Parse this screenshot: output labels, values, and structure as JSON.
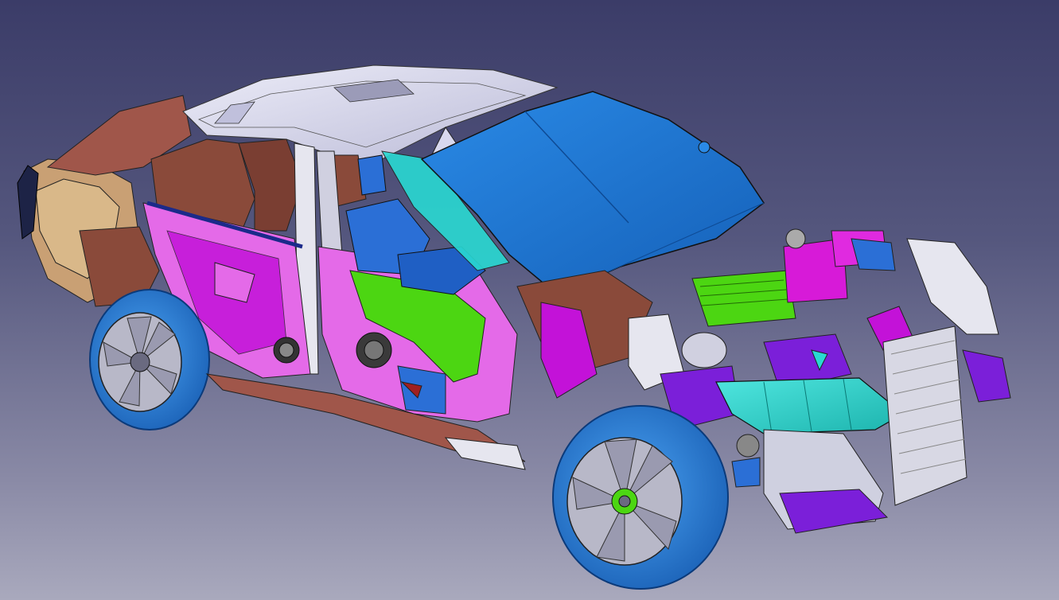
{
  "viewport": {
    "background_top": "#3b3c68",
    "background_bottom": "#a9a9bd"
  },
  "model": {
    "colors": {
      "hood": "#1f78d1",
      "roof": "#d8d8ee",
      "tire": "#2f86e0",
      "rim": "#b8b8c8",
      "door_panel": "#e46ae8",
      "magenta": "#c312d8",
      "green": "#4cd612",
      "cyan": "#29d9d2",
      "brown": "#8a4a3a",
      "tan": "#d9b889",
      "purple": "#7b1fd9",
      "seat_blue": "#2b6fd6",
      "frame_white": "#e6e6ef"
    }
  }
}
